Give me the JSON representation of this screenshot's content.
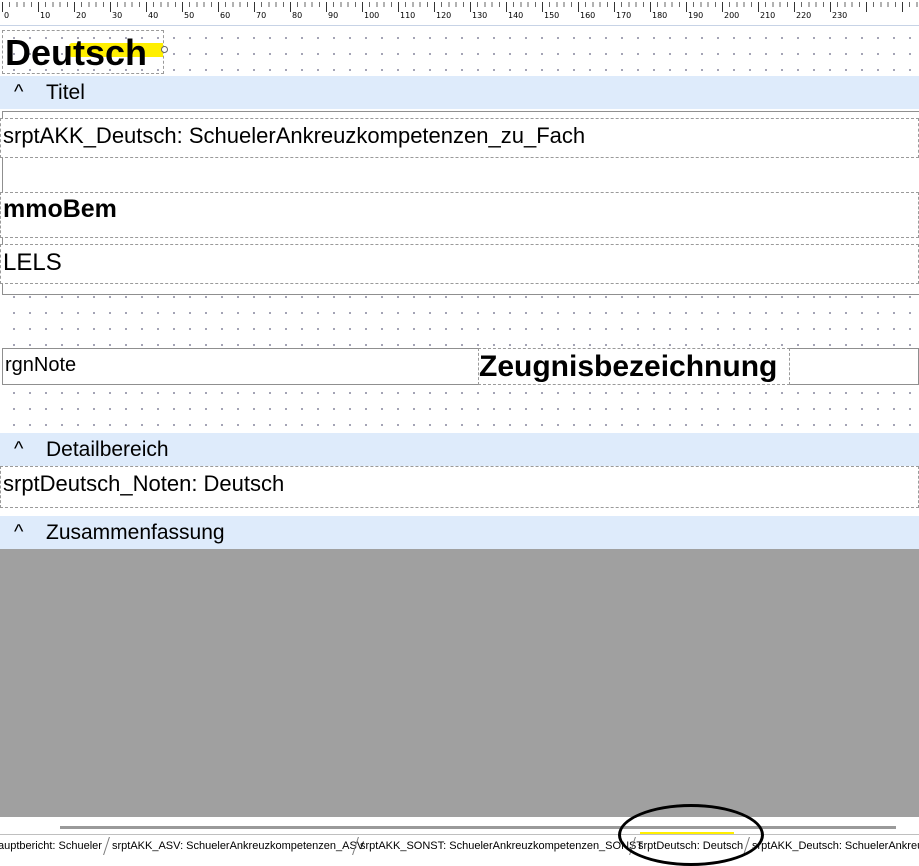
{
  "ruler": {
    "labels": [
      "0",
      "10",
      "20",
      "30",
      "40",
      "50",
      "60",
      "70",
      "80",
      "90",
      "100",
      "110",
      "120",
      "130",
      "140",
      "150",
      "160",
      "170",
      "180",
      "190",
      "200",
      "210",
      "220",
      "230"
    ]
  },
  "page_header": {
    "title_text": "Deutsch",
    "title_highlight_color": "#ffef00"
  },
  "bands": {
    "titel": {
      "caret": "^",
      "label": "Titel"
    },
    "detail": {
      "caret": "^",
      "label": "Detailbereich"
    },
    "summary": {
      "caret": "^",
      "label": "Zusammenfassung"
    }
  },
  "fields": {
    "subreport_akk": "srptAKK_Deutsch: SchuelerAnkreuzkompetenzen_zu_Fach",
    "memo_bem": "mmoBem",
    "lels": "LELS",
    "rgn_note": "rgnNote",
    "zeugnis": "Zeugnisbezeichnung",
    "subreport_noten": "srptDeutsch_Noten: Deutsch"
  },
  "tabs": [
    {
      "label": "auptbericht: Schueler"
    },
    {
      "label": "srptAKK_ASV: SchuelerAnkreuzkompetenzen_ASV"
    },
    {
      "label": "srptAKK_SONST: SchuelerAnkreuzkompetenzen_SONST"
    },
    {
      "label": "srptDeutsch: Deutsch"
    },
    {
      "label": "srptAKK_Deutsch: SchuelerAnkreuzkompetenzen_zu_Fach"
    }
  ],
  "colors": {
    "band_bg": "#deebfb",
    "empty_area": "#a0a0a0",
    "highlight": "#ffef00",
    "annotation_circle": "#000000"
  }
}
